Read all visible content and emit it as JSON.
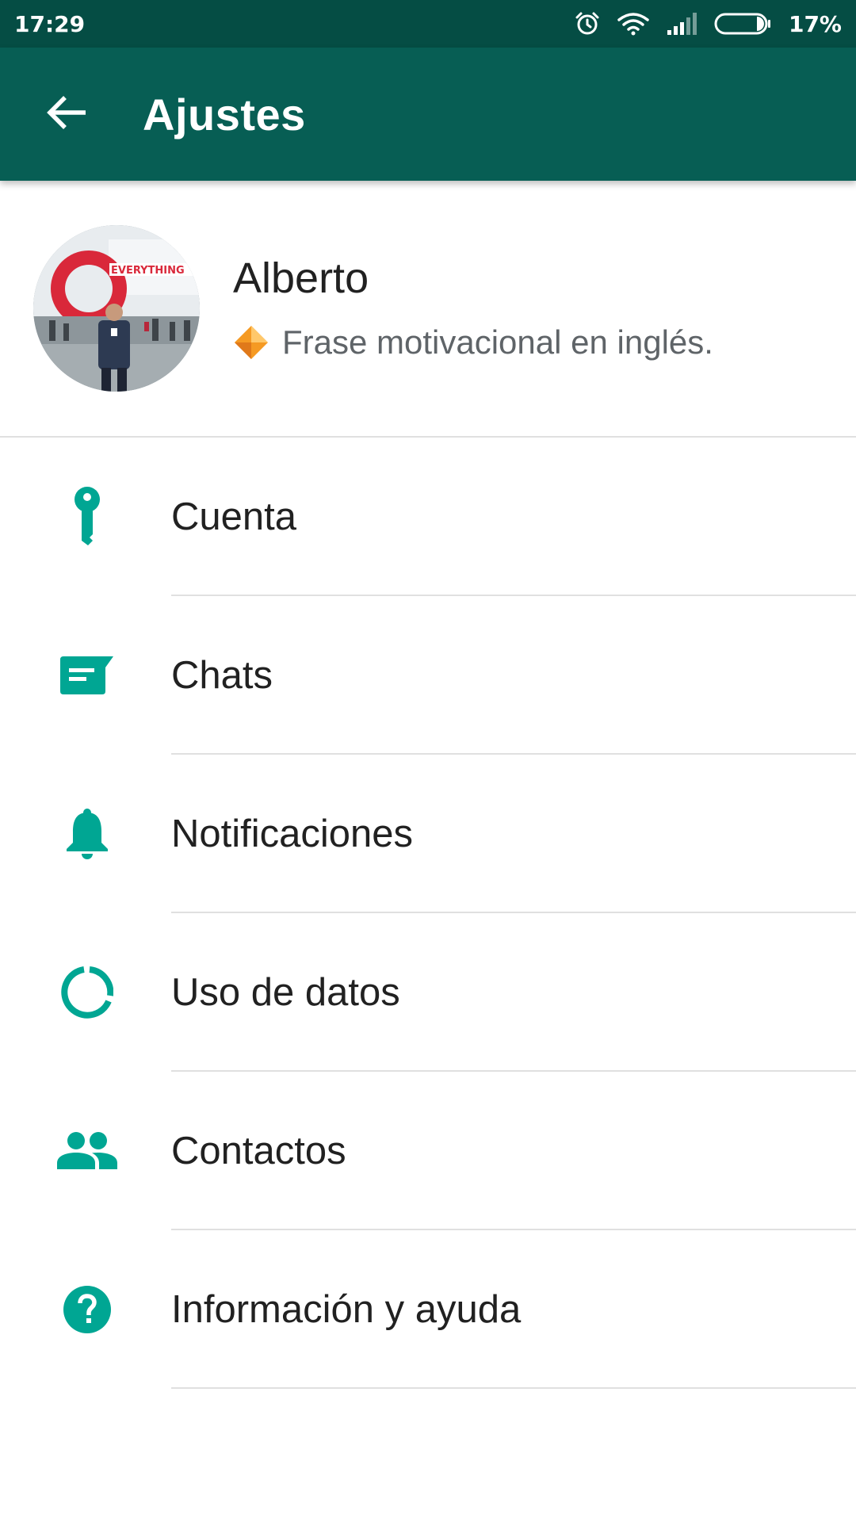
{
  "status_bar": {
    "time": "17:29",
    "battery": "17%",
    "icons": [
      "alarm-icon",
      "wifi-icon",
      "signal-icon",
      "battery-icon"
    ]
  },
  "app_bar": {
    "title": "Ajustes",
    "back_icon": "arrow-back-icon"
  },
  "profile": {
    "name": "Alberto",
    "status": "Frase motivacional en inglés.",
    "status_emoji": "orange-diamond",
    "avatar_sign_text": "EVERYTHING"
  },
  "menu": {
    "items": [
      {
        "label": "Cuenta",
        "icon": "key-icon"
      },
      {
        "label": "Chats",
        "icon": "chat-icon"
      },
      {
        "label": "Notificaciones",
        "icon": "bell-icon"
      },
      {
        "label": "Uso de datos",
        "icon": "data-usage-icon"
      },
      {
        "label": "Contactos",
        "icon": "contacts-icon"
      },
      {
        "label": "Información y ayuda",
        "icon": "help-icon"
      }
    ]
  },
  "colors": {
    "status_bar": "#054d44",
    "app_bar": "#075e54",
    "icon_teal": "#00a693",
    "divider": "#e0e0e0",
    "text_primary": "#212121",
    "text_secondary": "#5f6468"
  }
}
